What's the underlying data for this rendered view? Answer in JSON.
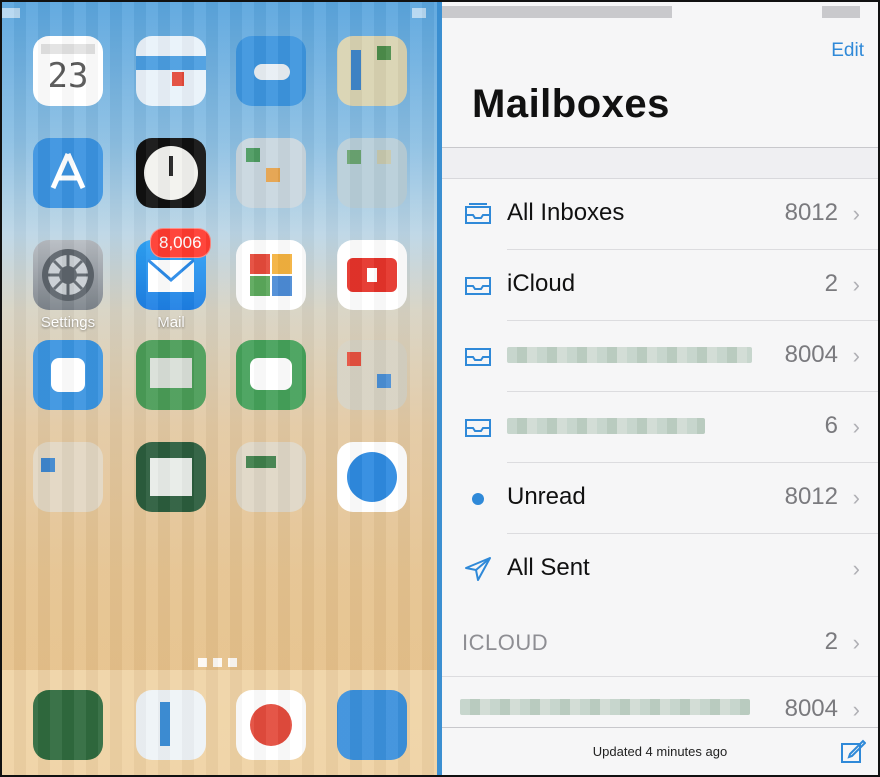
{
  "home": {
    "apps": {
      "calendar_day": "23",
      "settings_label": "Settings",
      "mail_label": "Mail",
      "mail_badge": "8,006"
    }
  },
  "mail": {
    "edit_label": "Edit",
    "title": "Mailboxes",
    "rows": [
      {
        "label": "All Inboxes",
        "count": "8012",
        "icon": "inbox-tray-icon"
      },
      {
        "label": "iCloud",
        "count": "2",
        "icon": "inbox-tray-icon"
      },
      {
        "label": "",
        "count": "8004",
        "icon": "inbox-tray-icon"
      },
      {
        "label": "",
        "count": "6",
        "icon": "inbox-tray-icon"
      },
      {
        "label": "Unread",
        "count": "8012",
        "icon": "unread-dot-icon"
      },
      {
        "label": "All Sent",
        "count": "",
        "icon": "paper-plane-icon"
      }
    ],
    "section": {
      "label": "ICLOUD",
      "count": "2"
    },
    "bottom_row": {
      "count": "8004"
    },
    "toolbar": {
      "updated": "Updated 4 minutes ago"
    }
  },
  "colors": {
    "accent": "#2f89d8",
    "badge": "#ff3b30",
    "divider": "#3b8fd1"
  }
}
